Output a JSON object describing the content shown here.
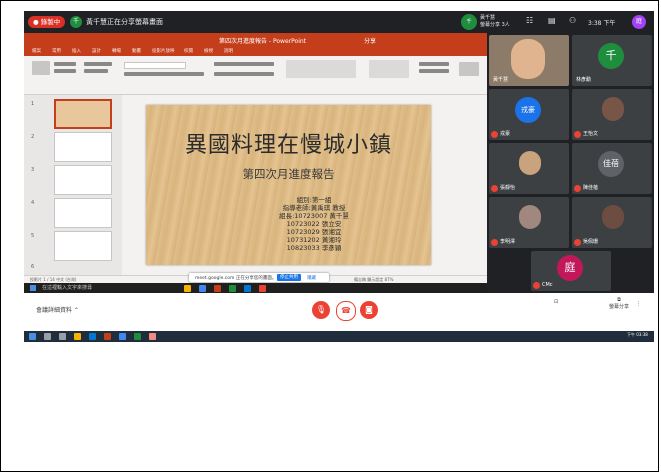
{
  "meet": {
    "rec_label": "● 錄製中",
    "presenter_initial": "千",
    "title": "黃千慧正在分享螢幕畫面",
    "speaker_line1": "黃千慧",
    "speaker_line2": "螢幕分享 3人",
    "clock": "3:38 下午",
    "user_initial": "庭",
    "meeting_code": "會議詳細資料 ⌃",
    "present_label": "螢幕分享",
    "participants_count": "全部 13"
  },
  "ppt": {
    "app_title": "第四次月進度報告 - PowerPoint",
    "share_label": "分享",
    "tabs": [
      "檔案",
      "常用",
      "插入",
      "設計",
      "轉場",
      "動畫",
      "投影片放映",
      "校閱",
      "檢視",
      "說明"
    ],
    "slide_numbers": [
      "1",
      "2",
      "3",
      "4",
      "5",
      "6"
    ],
    "status_left": "投影片 1 / 14   中文 (台灣)",
    "status_right": "備忘稿   顯示設定   87%"
  },
  "slide": {
    "title": "異國料理在慢城小鎮",
    "subtitle": "第四次月進度報告",
    "lines": [
      "組別:第一組",
      "指導老師:黃禹琪 教授",
      "組長:10723007 黃千慧",
      "10723022 張立安",
      "10723029 張湘宜",
      "10731202 黃湘玲",
      "10823033 李彥穎"
    ]
  },
  "banner": {
    "text": "meet.google.com 正在分享您的畫面。",
    "stop_label": "停止共用",
    "hide_label": "隱藏"
  },
  "participants": [
    {
      "name": "黃千慧",
      "initial": "千",
      "color": "#1e8e3e"
    },
    {
      "name": "林彥勳",
      "initial": "",
      "color": "#8d6e63"
    },
    {
      "name": "戎豪",
      "initial": "戎豪",
      "color": "#1a73e8"
    },
    {
      "name": "王怡文",
      "initial": "",
      "color": "#795548"
    },
    {
      "name": "張靜怡",
      "initial": "",
      "color": "#c9a27e"
    },
    {
      "name": "陳佳蓓",
      "initial": "佳蓓",
      "color": "#5f6368"
    },
    {
      "name": "李明澤",
      "initial": "",
      "color": "#a1887f"
    },
    {
      "name": "吳佩珊",
      "initial": "",
      "color": "#6d4c41"
    },
    {
      "name": "CMc",
      "initial": "庭",
      "color": "#c2185b"
    }
  ],
  "taskbar": {
    "search_placeholder": "在這裡輸入文字來搜尋",
    "time": "下午 03:38"
  }
}
